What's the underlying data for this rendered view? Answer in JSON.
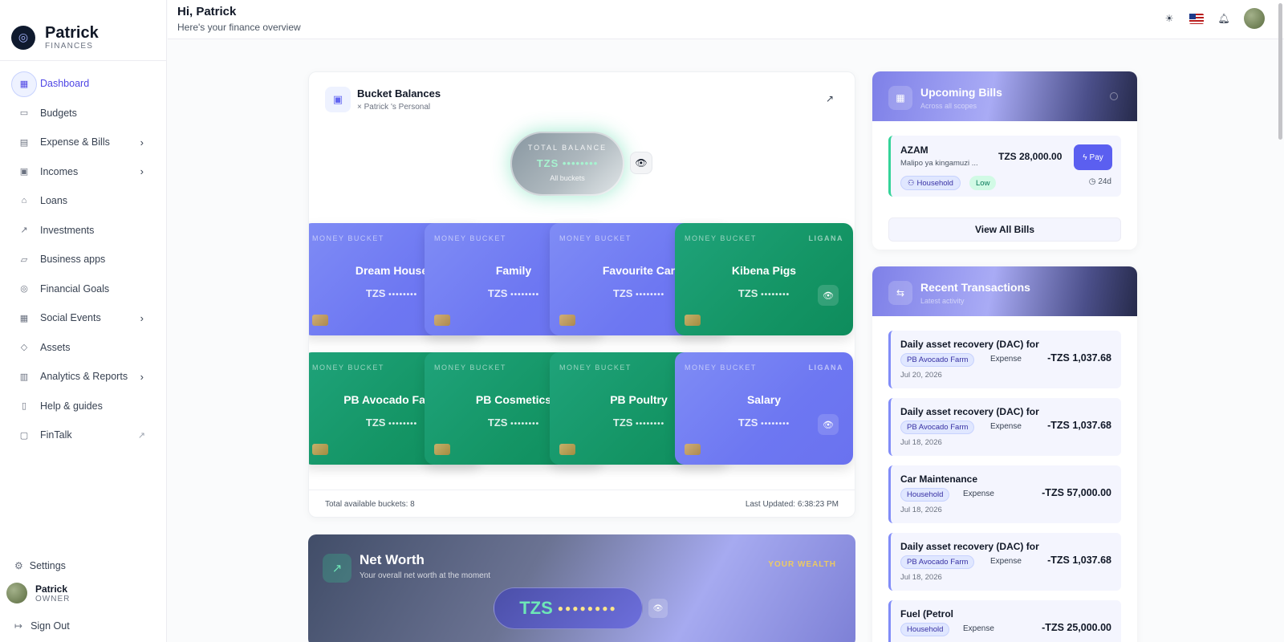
{
  "brand": {
    "name": "Patrick",
    "sub": "FINANCES"
  },
  "sidebar": {
    "items": [
      {
        "label": "Dashboard",
        "icon": "grid-icon"
      },
      {
        "label": "Budgets",
        "icon": "card-icon"
      },
      {
        "label": "Expense & Bills",
        "icon": "receipt-icon"
      },
      {
        "label": "Incomes",
        "icon": "cash-icon"
      },
      {
        "label": "Loans",
        "icon": "bank-icon"
      },
      {
        "label": "Investments",
        "icon": "trend-icon"
      },
      {
        "label": "Business apps",
        "icon": "folder-icon"
      },
      {
        "label": "Financial Goals",
        "icon": "target-icon"
      },
      {
        "label": "Social Events",
        "icon": "calendar-icon"
      },
      {
        "label": "Assets",
        "icon": "box-icon"
      },
      {
        "label": "Analytics & Reports",
        "icon": "chart-icon"
      },
      {
        "label": "Help & guides",
        "icon": "book-icon"
      },
      {
        "label": "FinTalk",
        "icon": "chat-icon"
      }
    ],
    "settings": "Settings",
    "user": {
      "name": "Patrick",
      "role": "OWNER"
    },
    "signout": "Sign Out"
  },
  "header": {
    "greeting": "Hi, Patrick",
    "subtitle": "Here's your finance overview"
  },
  "buckets": {
    "title": "Bucket Balances",
    "subtitle": "× Patrick 's Personal",
    "total": {
      "label": "TOTAL BALANCE",
      "value": "TZS ••••••••",
      "sub": "All buckets"
    },
    "cards": [
      {
        "name": "Dream House",
        "color": "blue",
        "tag": "MONEY BUCKET",
        "brand": "",
        "currency": "TZS",
        "masked": "••••••••"
      },
      {
        "name": "Family",
        "color": "blue",
        "tag": "MONEY BUCKET",
        "brand": "",
        "currency": "TZS",
        "masked": "••••••••"
      },
      {
        "name": "Favourite Car",
        "color": "blue",
        "tag": "MONEY BUCKET",
        "brand": "",
        "currency": "TZS",
        "masked": "••••••••"
      },
      {
        "name": "Kibena Pigs",
        "color": "green",
        "tag": "MONEY BUCKET",
        "brand": "LIGANA",
        "currency": "TZS",
        "masked": "••••••••"
      },
      {
        "name": "PB Avocado Farm",
        "color": "green",
        "tag": "MONEY BUCKET",
        "brand": "",
        "currency": "TZS",
        "masked": "••••••••"
      },
      {
        "name": "PB Cosmetics",
        "color": "green",
        "tag": "MONEY BUCKET",
        "brand": "",
        "currency": "TZS",
        "masked": "••••••••"
      },
      {
        "name": "PB Poultry",
        "color": "green",
        "tag": "MONEY BUCKET",
        "brand": "",
        "currency": "TZS",
        "masked": "••••••••"
      },
      {
        "name": "Salary",
        "color": "blue",
        "tag": "MONEY BUCKET",
        "brand": "LIGANA",
        "currency": "TZS",
        "masked": "••••••••"
      }
    ],
    "footer_left": "Total available buckets: 8",
    "footer_right": "Last Updated: 6:38:23 PM"
  },
  "networth": {
    "title": "Net Worth",
    "subtitle": "Your overall net worth at the moment",
    "badge": "YOUR WEALTH",
    "currency": "TZS",
    "masked": "●●●●●●●●"
  },
  "bills": {
    "title": "Upcoming Bills",
    "subtitle": "Across all scopes",
    "item": {
      "name": "AZAM",
      "desc": "Malipo ya kingamuzi ...",
      "amount": "TZS 28,000.00",
      "pay": "Pay",
      "scope": "Household",
      "priority": "Low",
      "days": "24d"
    },
    "view_all": "View All Bills"
  },
  "transactions": {
    "title": "Recent Transactions",
    "subtitle": "Latest activity",
    "items": [
      {
        "title": "Daily asset recovery (DAC) for",
        "tag": "PB Avocado Farm",
        "type": "Expense",
        "amount": "-TZS 1,037.68",
        "date": "Jul 20, 2026"
      },
      {
        "title": "Daily asset recovery (DAC) for",
        "tag": "PB Avocado Farm",
        "type": "Expense",
        "amount": "-TZS 1,037.68",
        "date": "Jul 18, 2026"
      },
      {
        "title": "Car Maintenance",
        "tag": "Household",
        "type": "Expense",
        "amount": "-TZS 57,000.00",
        "date": "Jul 18, 2026"
      },
      {
        "title": "Daily asset recovery (DAC) for",
        "tag": "PB Avocado Farm",
        "type": "Expense",
        "amount": "-TZS 1,037.68",
        "date": "Jul 18, 2026"
      },
      {
        "title": "Fuel (Petrol",
        "tag": "Household",
        "type": "Expense",
        "amount": "-TZS 25,000.00",
        "date": ""
      }
    ]
  }
}
